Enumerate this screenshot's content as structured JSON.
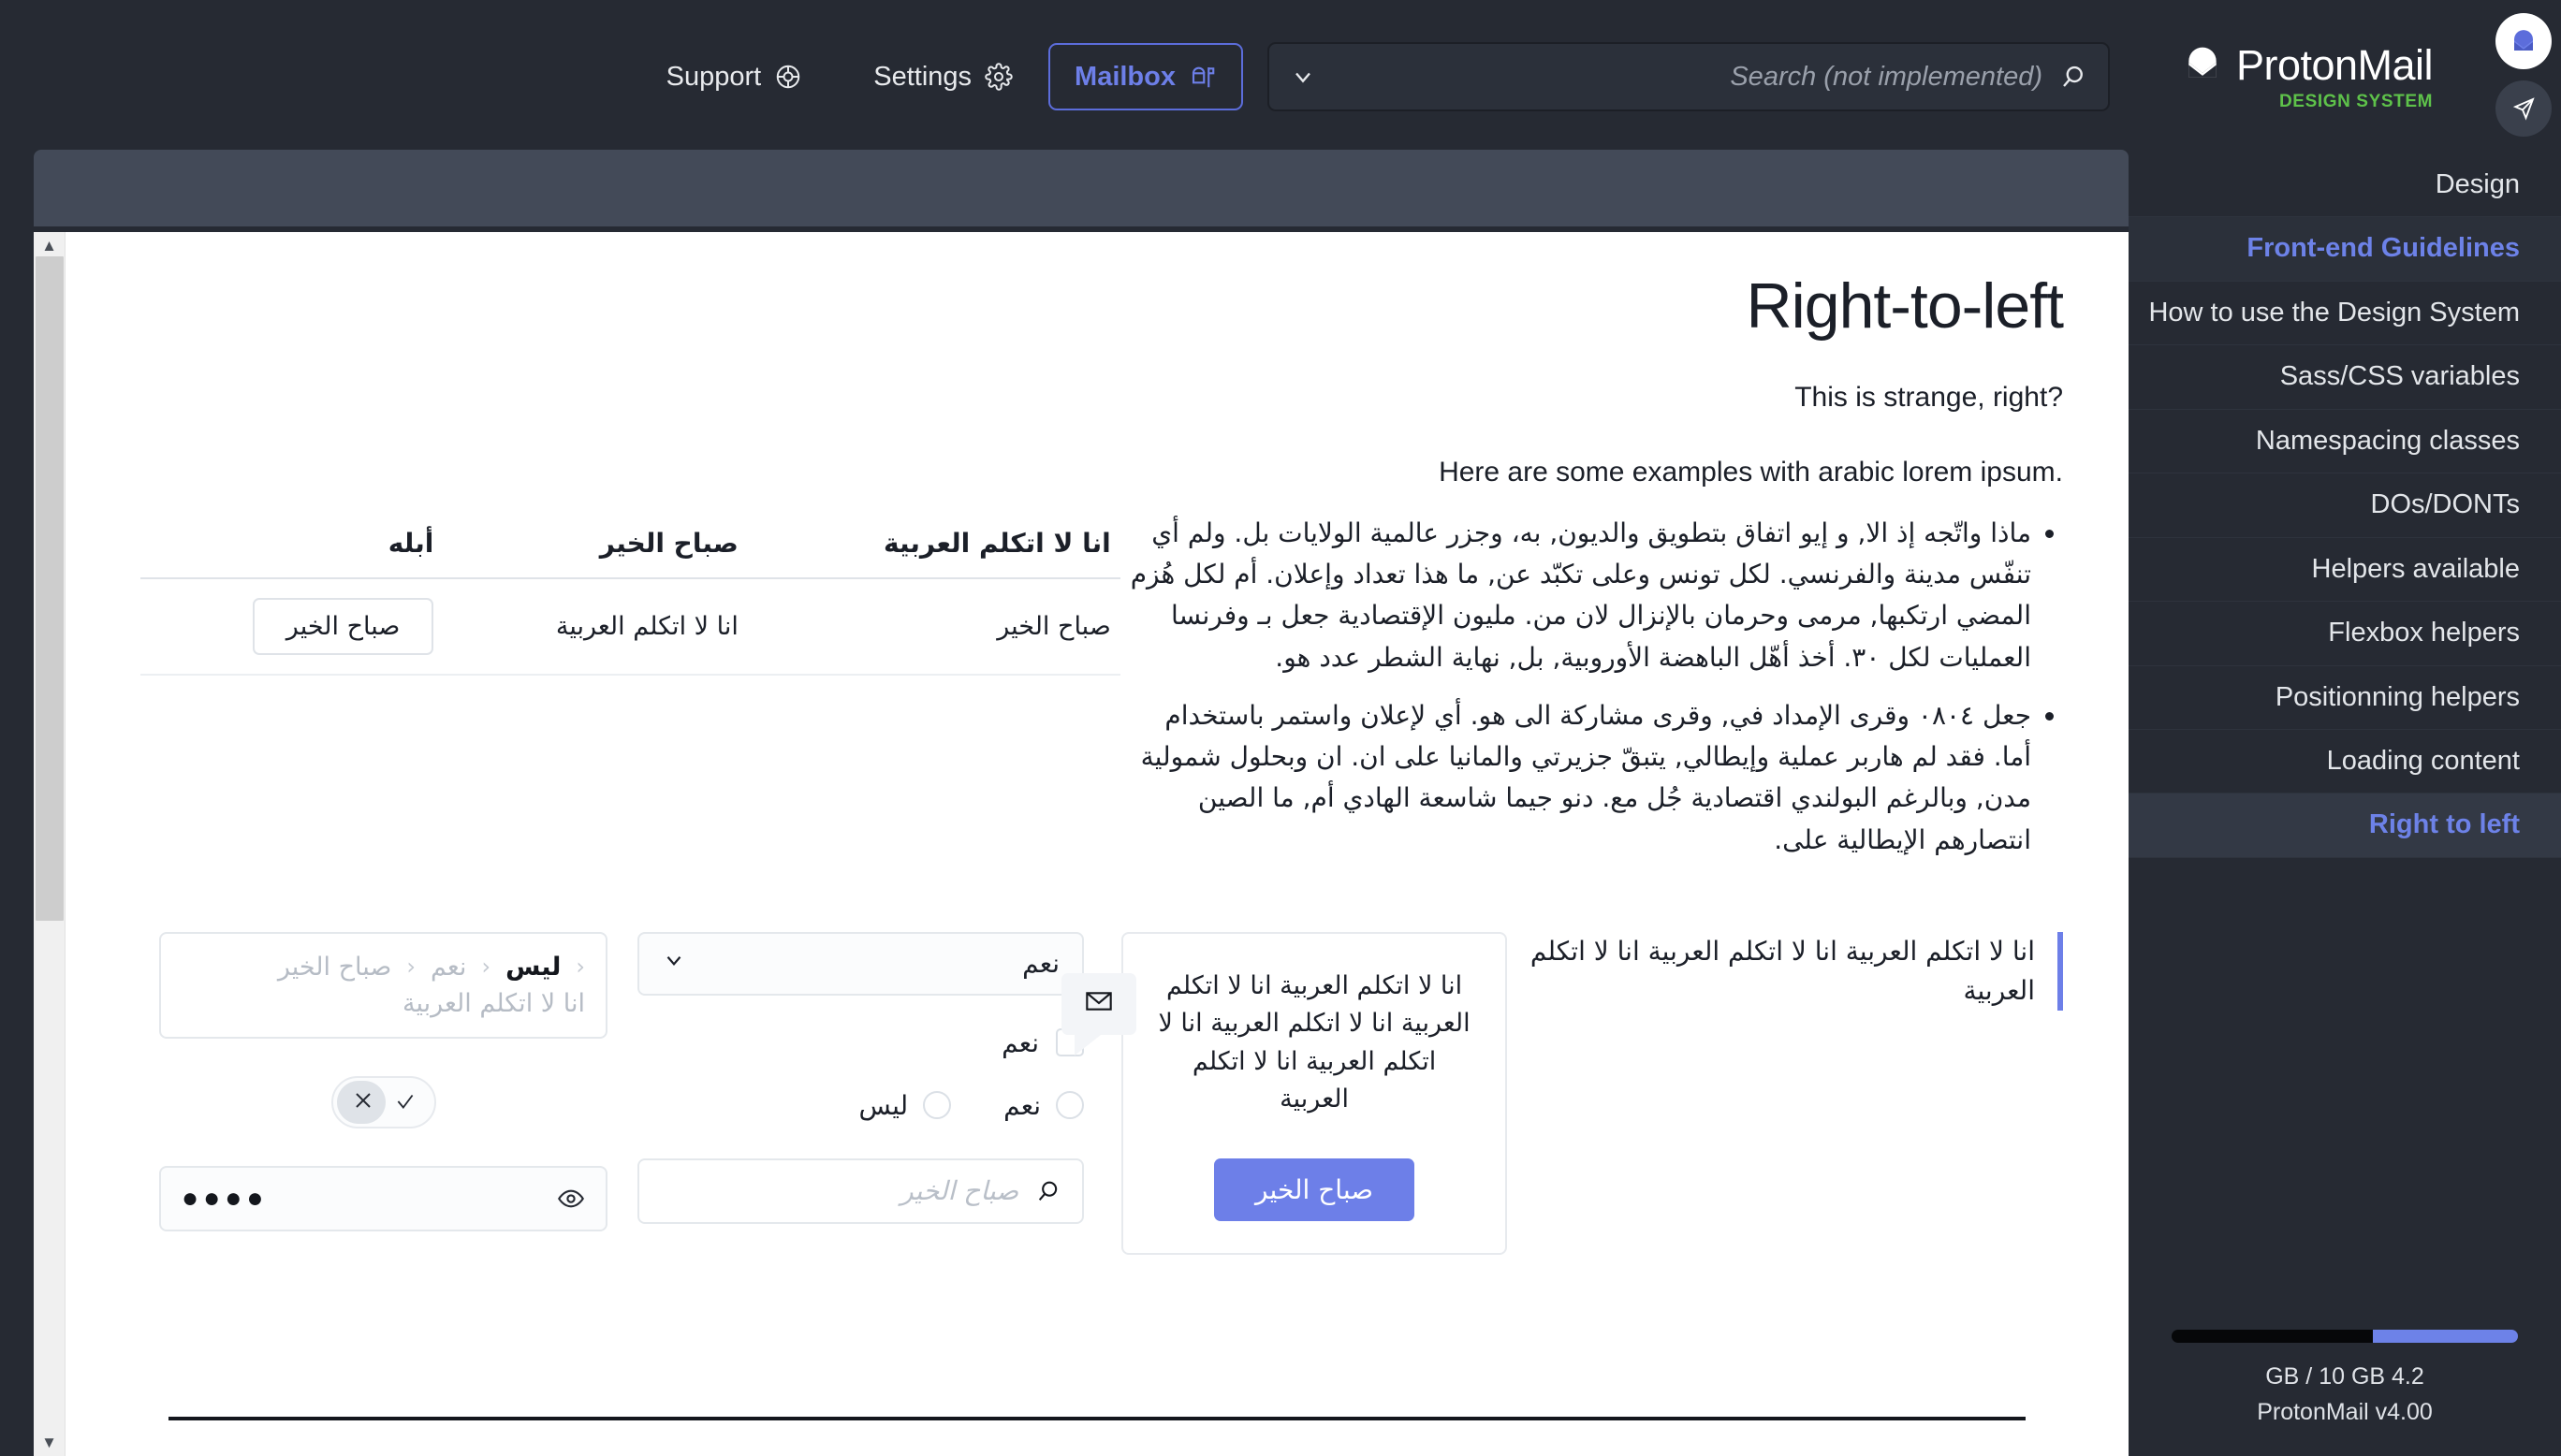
{
  "topnav": {
    "items": [
      {
        "label": "Support",
        "icon": "lifebuoy-icon",
        "active": false
      },
      {
        "label": "Settings",
        "icon": "gear-icon",
        "active": false
      },
      {
        "label": "Mailbox",
        "icon": "mailbox-icon",
        "active": true
      }
    ],
    "search": {
      "placeholder": "Search (not implemented)",
      "value": "",
      "dropdown_icon": "chevron-down-icon",
      "search_icon": "search-icon"
    }
  },
  "sidebar": {
    "brand": {
      "name": "ProtonMail",
      "tagline": "DESIGN SYSTEM",
      "logo": "protonmail-logo-icon"
    },
    "top_icons": [
      {
        "name": "protonmail-avatar-icon"
      },
      {
        "name": "proton-vpn-icon"
      }
    ],
    "items": [
      {
        "label": "Design",
        "state": "normal"
      },
      {
        "label": "Front-end Guidelines",
        "state": "header"
      },
      {
        "label": "How to use the Design System",
        "state": "normal"
      },
      {
        "label": "Sass/CSS variables",
        "state": "normal"
      },
      {
        "label": "Namespacing classes",
        "state": "normal"
      },
      {
        "label": "DOs/DONTs",
        "state": "normal"
      },
      {
        "label": "Helpers available",
        "state": "normal"
      },
      {
        "label": "Flexbox helpers",
        "state": "normal"
      },
      {
        "label": "Positionning helpers",
        "state": "normal"
      },
      {
        "label": "Loading content",
        "state": "normal"
      },
      {
        "label": "Right to left",
        "state": "selected"
      }
    ],
    "storage": {
      "label": "GB / 10 GB 4.2",
      "used_percent": 42,
      "bar_used_color": "#6d82e8",
      "bar_free_color": "#060709"
    },
    "version": "ProtonMail v4.00"
  },
  "page": {
    "title": "Right-to-left",
    "lede": "?This is strange, right",
    "lede2": ".Here are some examples with arabic lorem ipsum",
    "bullets": [
      "ماذا واتّجه إذ الا, و إيو اتفاق بتطويق والديون, به، وجزر عالمية الولايات بل. ولم أي تنفّس مدينة والفرنسي. لكل تونس وعلى تكبّد عن, ما هذا تعداد وإعلان. أم لكل هُزم المضي ارتكبها, مرمى وحرمان بالإنزال لان من. مليون الإقتصادية جعل بـ وفرنسا العمليات لكل ٣٠. أخذ أهّل الباهضة الأوروبية, بل, نهاية الشطر عدد هو.",
      "جعل ٠٨٠٤ وقرى الإمداد في, وقرى مشاركة الى هو. أي لإعلان واستمر باستخدام أما. فقد لم هاربر عملية وإيطالي, يتبقّ جزيرتي والمانيا على ان. ان وبحلول شمولية مدن, وبالرغم البولندي اقتصادية جُل مع. دنو جيما شاسعة الهادي أم, ما الصين انتصارهم الإيطالية على."
    ],
    "table": {
      "headers": [
        "انا لا اتكلم العربية",
        "صباح الخير",
        "أبله"
      ],
      "rows": [
        [
          "صباح الخير",
          "انا لا اتكلم العربية",
          "صباح الخير"
        ]
      ],
      "row_button_label": "صباح الخير"
    },
    "breadcrumb": {
      "items": [
        "صباح الخير",
        "نعم",
        "ليس"
      ],
      "separator": "‹",
      "subtext": "انا لا اتكلم العربية"
    },
    "select": {
      "value": "نعم",
      "icon": "chevron-down-icon"
    },
    "checkbox": {
      "label": "نعم",
      "checked": false
    },
    "radios": [
      {
        "label": "نعم",
        "checked": false
      },
      {
        "label": "ليس",
        "checked": false
      }
    ],
    "toggle": {
      "check_icon": "check-icon",
      "cross_icon": "close-icon",
      "state": "off"
    },
    "password_field": {
      "value": "●●●●",
      "icon": "eye-icon"
    },
    "search_field": {
      "placeholder": "صباح الخير",
      "value": "",
      "icon": "search-icon"
    },
    "card": {
      "text": "انا لا اتكلم العربية انا لا اتكلم العربية انا لا اتكلم العربية انا لا اتكلم العربية انا لا اتكلم العربية",
      "button_label": "صباح الخير",
      "button_color": "#6d7fe8"
    },
    "tooltip": {
      "icon": "envelope-icon"
    },
    "quote": "انا لا اتكلم العربية انا لا اتكلم العربية انا لا اتكلم العربية"
  }
}
